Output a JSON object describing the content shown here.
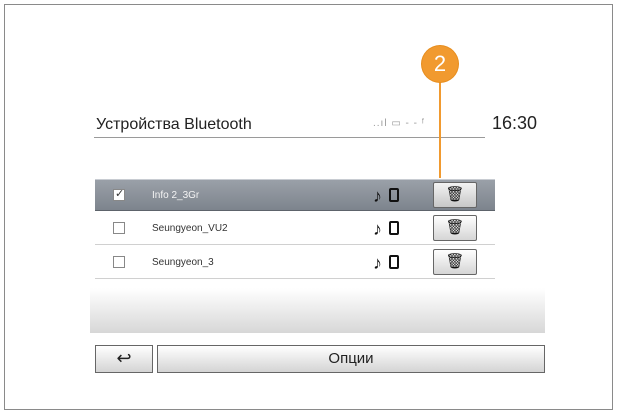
{
  "header": {
    "title": "Устройства Bluetooth",
    "status": "..ıl ▭ - - ᶠ",
    "clock": "16:30"
  },
  "devices": [
    {
      "name": "Info 2_3Gr",
      "checked": true
    },
    {
      "name": "Seungyeon_VU2",
      "checked": false
    },
    {
      "name": "Seungyeon_3",
      "checked": false
    }
  ],
  "icons": {
    "music": "♪",
    "trash": "🗑",
    "back": "↩"
  },
  "footer": {
    "options": "Опции"
  },
  "callout": "2",
  "colors": {
    "callout": "#f19a2f",
    "selected": "#8c939c"
  }
}
